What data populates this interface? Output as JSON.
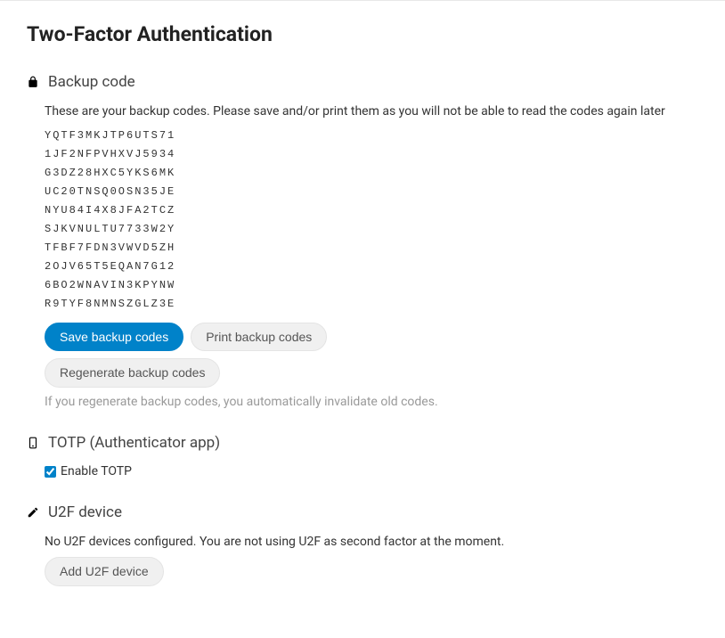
{
  "page": {
    "title": "Two-Factor Authentication"
  },
  "backup": {
    "heading": "Backup code",
    "description": "These are your backup codes. Please save and/or print them as you will not be able to read the codes again later",
    "codes": [
      "YQTF3MKJTP6UTS71",
      "1JF2NFPVHXVJ5934",
      "G3DZ28HXC5YKS6MK",
      "UC20TNSQ0OSN35JE",
      "NYU84I4X8JFA2TCZ",
      "SJKVNULTU7733W2Y",
      "TFBF7FDN3VWVD5ZH",
      "2OJV65T5EQAN7G12",
      "6BO2WNAVIN3KPYNW",
      "R9TYF8NMNSZGLZ3E"
    ],
    "save_label": "Save backup codes",
    "print_label": "Print backup codes",
    "regenerate_label": "Regenerate backup codes",
    "regenerate_note": "If you regenerate backup codes, you automatically invalidate old codes."
  },
  "totp": {
    "heading": "TOTP (Authenticator app)",
    "enable_label": "Enable TOTP",
    "enabled": true
  },
  "u2f": {
    "heading": "U2F device",
    "status": "No U2F devices configured. You are not using U2F as second factor at the moment.",
    "add_label": "Add U2F device"
  }
}
